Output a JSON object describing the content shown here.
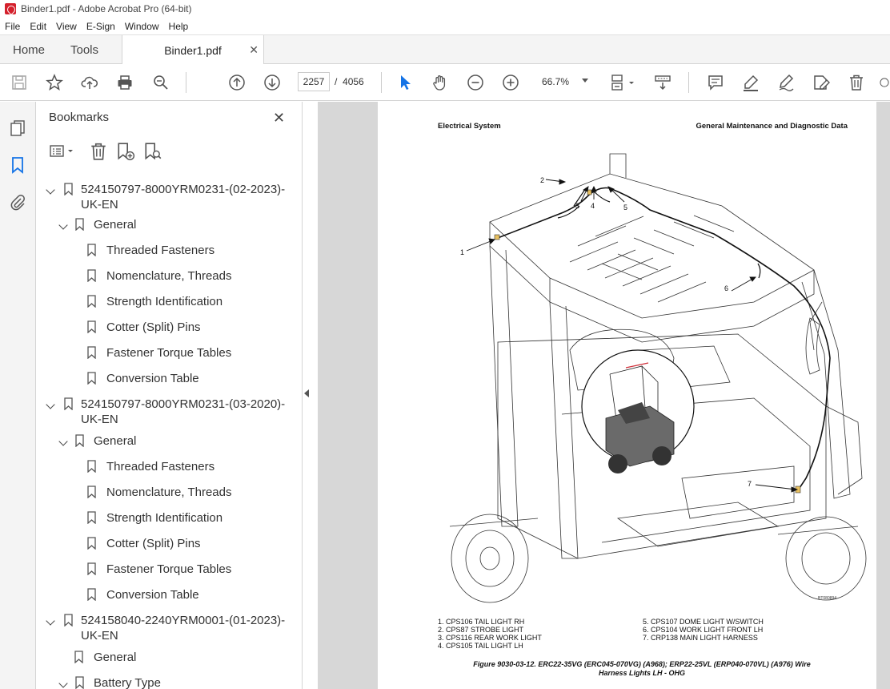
{
  "window": {
    "title": "Binder1.pdf - Adobe Acrobat Pro (64-bit)"
  },
  "menu": [
    "File",
    "Edit",
    "View",
    "E-Sign",
    "Window",
    "Help"
  ],
  "tabs": {
    "home": "Home",
    "tools": "Tools",
    "document": "Binder1.pdf"
  },
  "toolbar": {
    "page_current": "2257",
    "page_separator": "/",
    "page_total": "4056",
    "zoom": "66.7%"
  },
  "bookmarks": {
    "title": "Bookmarks",
    "items": [
      {
        "label": "524150797-8000YRM0231-(02-2023)-",
        "label2": "UK-EN"
      },
      {
        "label": "General"
      },
      {
        "label": "Threaded Fasteners"
      },
      {
        "label": "Nomenclature, Threads"
      },
      {
        "label": "Strength Identification"
      },
      {
        "label": "Cotter (Split) Pins"
      },
      {
        "label": "Fastener Torque Tables"
      },
      {
        "label": "Conversion Table"
      },
      {
        "label": "524150797-8000YRM0231-(03-2020)-",
        "label2": "UK-EN"
      },
      {
        "label": "General"
      },
      {
        "label": "Threaded Fasteners"
      },
      {
        "label": "Nomenclature, Threads"
      },
      {
        "label": "Strength Identification"
      },
      {
        "label": "Cotter (Split) Pins"
      },
      {
        "label": "Fastener Torque Tables"
      },
      {
        "label": "Conversion Table"
      },
      {
        "label": "524158040-2240YRM0001-(01-2023)-",
        "label2": "UK-EN"
      },
      {
        "label": "General"
      },
      {
        "label": "Battery Type"
      }
    ]
  },
  "document": {
    "header_left": "Electrical System",
    "header_right": "General Maintenance and Diagnostic Data",
    "callouts": [
      "1",
      "2",
      "3",
      "4",
      "5",
      "6",
      "7"
    ],
    "legend_left": [
      "1.   CPS106 TAIL LIGHT RH",
      "2.   CPS87 STROBE LIGHT",
      "3.   CPS116 REAR WORK LIGHT",
      "4.   CPS105 TAIL LIGHT LH"
    ],
    "legend_right": [
      "5.   CPS107 DOME LIGHT W/SWITCH",
      "6.   CPS104 WORK LIGHT FRONT LH",
      "7.   CRP138 MAIN LIGHT HARNESS"
    ],
    "figure_code": "BT080894",
    "caption_line1": "Figure 9030-03-12. ERC22-35VG (ERC045-070VG) (A968); ERP22-25VL (ERP040-070VL) (A976) Wire",
    "caption_line2": "Harness Lights LH - OHG"
  }
}
